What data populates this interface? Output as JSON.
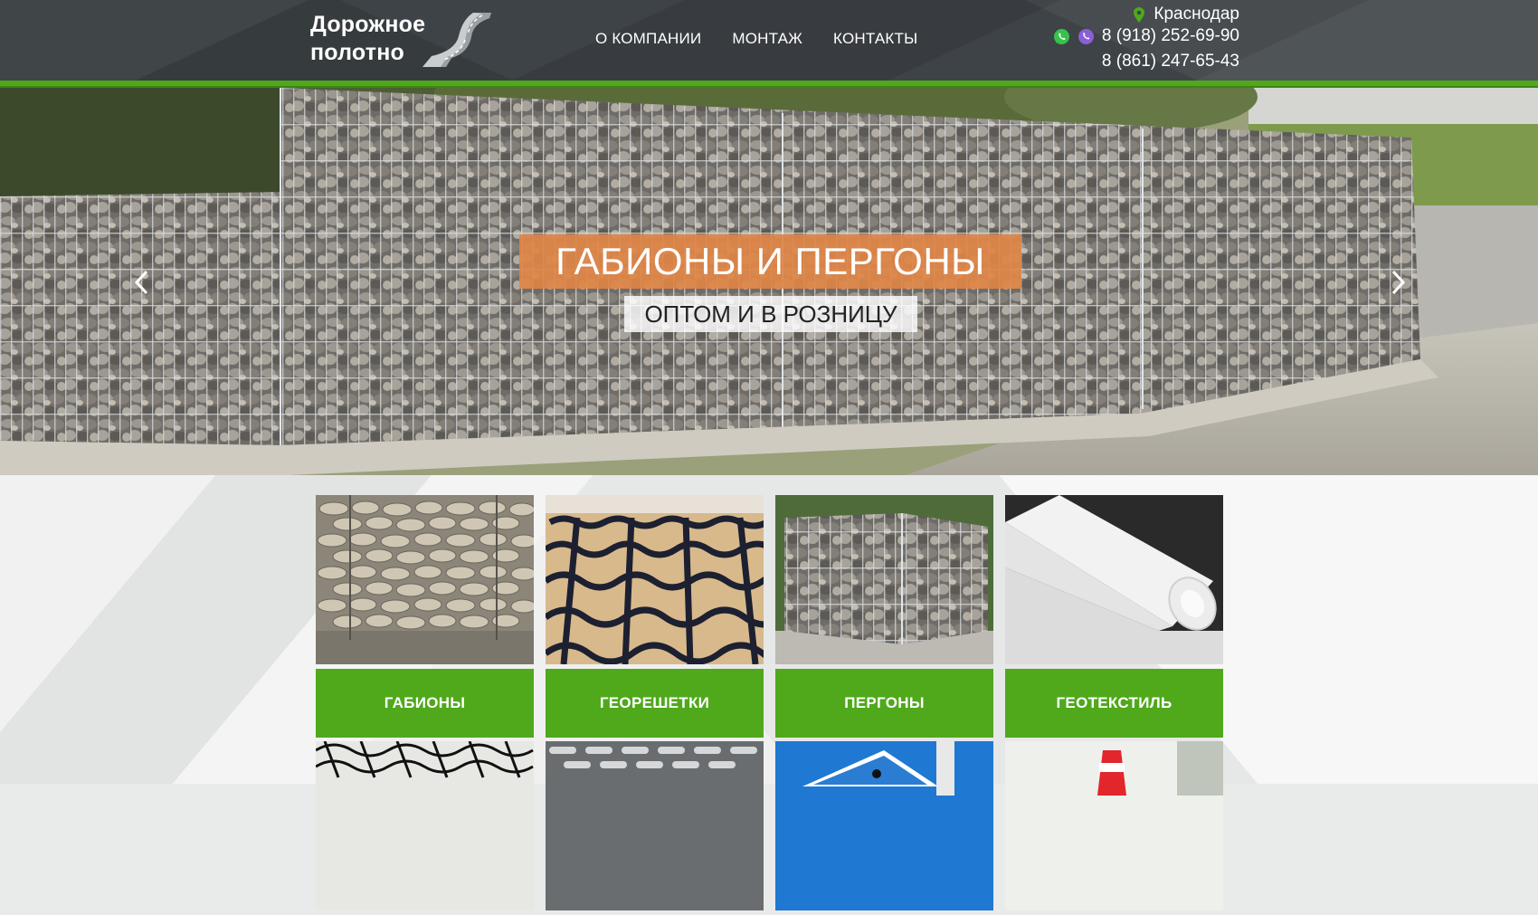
{
  "header": {
    "logo": {
      "line1": "Дорожное",
      "line2": "полотно"
    },
    "nav": [
      {
        "label": "О КОМПАНИИ"
      },
      {
        "label": "МОНТАЖ"
      },
      {
        "label": "КОНТАКТЫ"
      }
    ],
    "city": "Краснодар",
    "phone1": "8 (918) 252-69-90",
    "phone2": "8 (861) 247-65-43",
    "icons": [
      "map-pin-icon",
      "whatsapp-icon",
      "viber-icon"
    ]
  },
  "slider": {
    "title": "ГАБИОНЫ И ПЕРГОНЫ",
    "subtitle": "ОПТОМ И В РОЗНИЦУ"
  },
  "products": [
    {
      "label": "ГАБИОНЫ"
    },
    {
      "label": "ГЕОРЕШЕТКИ"
    },
    {
      "label": "ПЕРГОНЫ"
    },
    {
      "label": "ГЕОТЕКСТИЛЬ"
    }
  ],
  "colors": {
    "header_bg": "#3e4347",
    "accent_green": "#4fa91b",
    "slide_title_bg": "#df8546"
  }
}
